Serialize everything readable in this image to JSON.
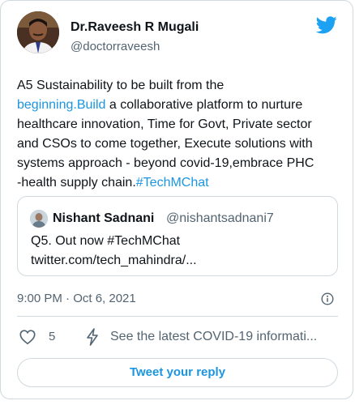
{
  "author": {
    "name": "Dr.Raveesh R Mugali",
    "handle": "@doctorraveesh"
  },
  "tweet": {
    "lines": [
      [
        {
          "text": "A5 Sustainability to be built from the",
          "link": false
        }
      ],
      [
        {
          "text": "beginning.Build",
          "link": true
        },
        {
          "text": " a collaborative platform to nurture",
          "link": false
        }
      ],
      [
        {
          "text": "healthcare innovation, Time for Govt, Private sector",
          "link": false
        }
      ],
      [
        {
          "text": "and CSOs to come together, Execute solutions with",
          "link": false
        }
      ],
      [
        {
          "text": "systems approach - beyond covid-19,embrace PHC",
          "link": false
        }
      ],
      [
        {
          "text": "-health supply chain.",
          "link": false
        },
        {
          "text": "#TechMChat",
          "link": true
        }
      ]
    ]
  },
  "quoted_tweet": {
    "name": "Nishant Sadnani",
    "handle": "@nishantsadnani7",
    "line1": "Q5. Out now #TechMChat",
    "line2": "twitter.com/tech_mahindra/..."
  },
  "timestamp": "9:00 PM · Oct 6, 2021",
  "actions": {
    "like_count": "5",
    "covid_link": "See the latest COVID-19 informati..."
  },
  "reply_button": "Tweet your reply",
  "colors": {
    "link": "#1b95e0",
    "twitter_blue": "#1da1f2",
    "secondary_text": "#536471",
    "border": "#cfd9de"
  },
  "icons": {
    "brand": "twitter-bird-icon",
    "info": "info-icon",
    "like": "heart-icon",
    "covid": "covid-info-icon"
  }
}
